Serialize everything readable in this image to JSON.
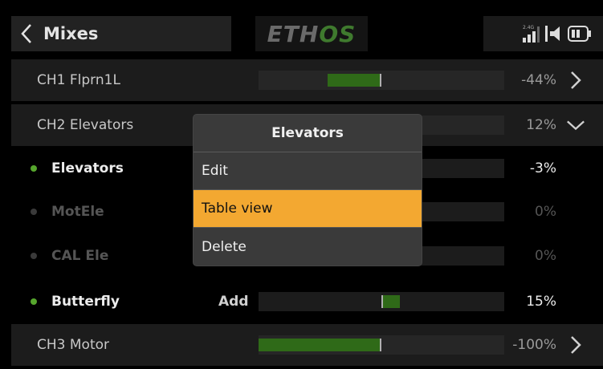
{
  "header": {
    "title": "Mixes",
    "logo_white": "ETH",
    "logo_green": "OS",
    "back_icon": "chevron-left-icon",
    "signal_label": "2.4G",
    "status_icons": [
      "signal-bars-icon",
      "speaker-icon",
      "battery-icon"
    ]
  },
  "rows": [
    {
      "kind": "channel",
      "label": "CH1 Flprn1L",
      "value": "-44%",
      "percent": -44,
      "arrow": "chevron-right-icon"
    },
    {
      "kind": "channel",
      "label": "CH2 Elevators",
      "value": "12%",
      "percent": 12,
      "arrow": "chevron-down-icon"
    },
    {
      "kind": "mix",
      "label": "Elevators",
      "value": "-3%",
      "percent": -3,
      "state": "active",
      "op": ""
    },
    {
      "kind": "mix",
      "label": "MotEle",
      "value": "0%",
      "percent": 0,
      "state": "inactive",
      "op": ""
    },
    {
      "kind": "mix",
      "label": "CAL Ele",
      "value": "0%",
      "percent": 0,
      "state": "inactive",
      "op": ""
    },
    {
      "kind": "mix",
      "label": "Butterfly",
      "value": "15%",
      "percent": 15,
      "state": "active",
      "op": "Add"
    },
    {
      "kind": "channel",
      "label": "CH3 Motor",
      "value": "-100%",
      "percent": -100,
      "arrow": "chevron-right-icon"
    }
  ],
  "popup": {
    "title": "Elevators",
    "items": [
      {
        "label": "Edit",
        "selected": false
      },
      {
        "label": "Table view",
        "selected": true
      },
      {
        "label": "Delete",
        "selected": false
      }
    ]
  },
  "colors": {
    "accent": "#f3a831",
    "bar_fill": "#2f6a18",
    "active_dot": "#56a62d"
  }
}
